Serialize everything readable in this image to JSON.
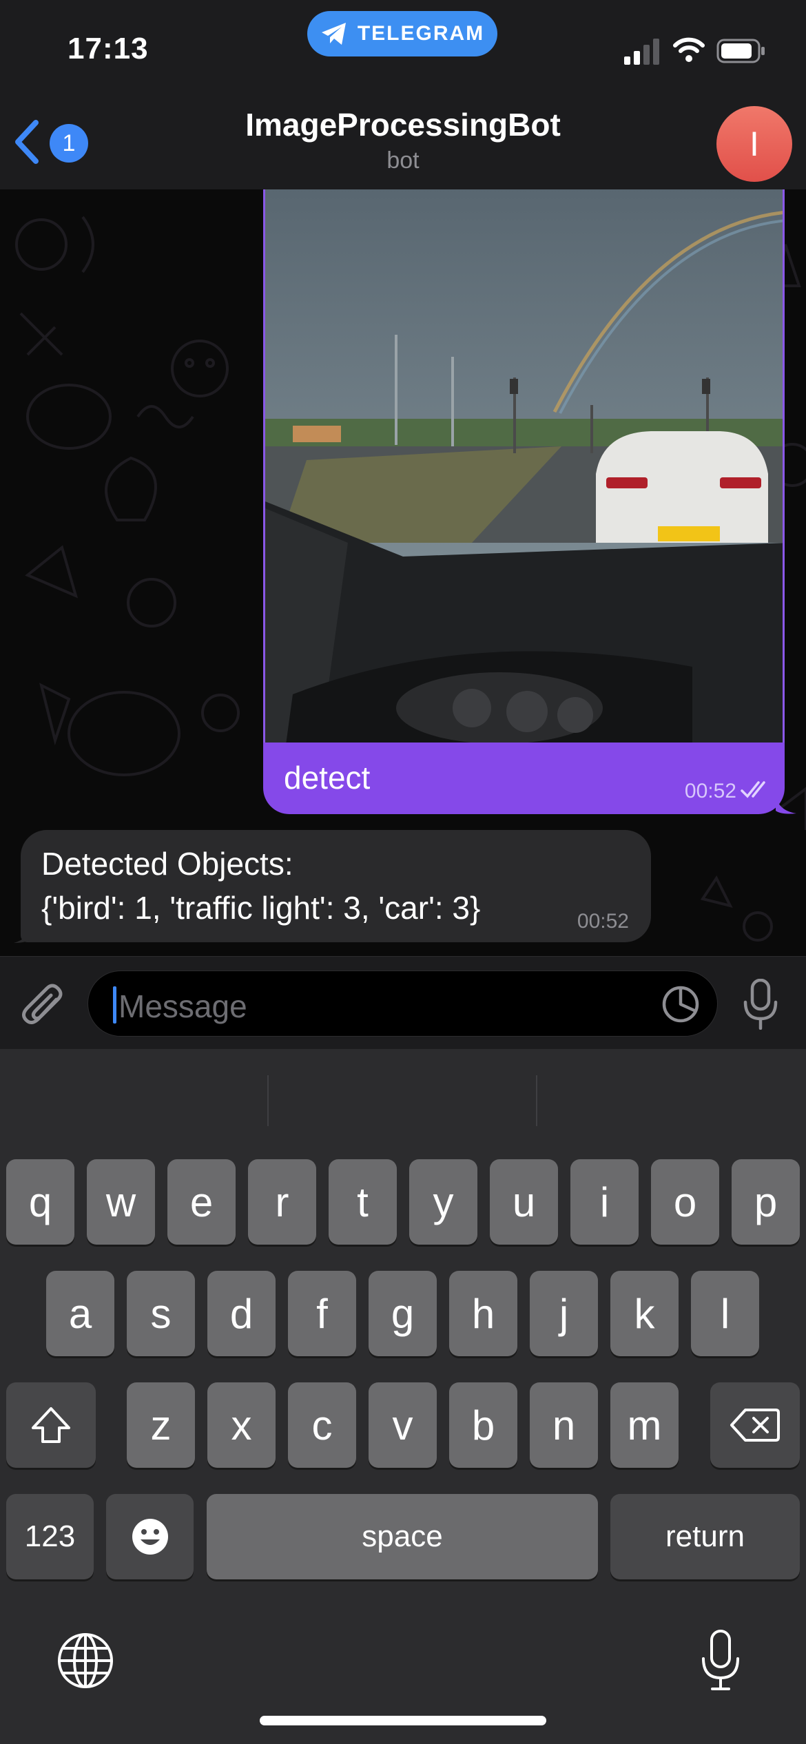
{
  "status": {
    "time": "17:13",
    "pill_label": "TELEGRAM"
  },
  "nav": {
    "back_badge": "1",
    "title": "ImageProcessingBot",
    "subtitle": "bot",
    "avatar_initial": "I"
  },
  "messages": {
    "outgoing": {
      "caption": "detect",
      "time": "00:52"
    },
    "incoming": {
      "line1": "Detected Objects:",
      "line2": "{'bird': 1, 'traffic light': 3, 'car': 3}",
      "time": "00:52"
    }
  },
  "input": {
    "placeholder": "Message"
  },
  "keyboard": {
    "row1": [
      "q",
      "w",
      "e",
      "r",
      "t",
      "y",
      "u",
      "i",
      "o",
      "p"
    ],
    "row2": [
      "a",
      "s",
      "d",
      "f",
      "g",
      "h",
      "j",
      "k",
      "l"
    ],
    "row3": [
      "z",
      "x",
      "c",
      "v",
      "b",
      "n",
      "m"
    ],
    "numbers_label": "123",
    "space_label": "space",
    "return_label": "return"
  },
  "colors": {
    "accent": "#3e88f7",
    "outgoing_bubble": "#8549e9",
    "incoming_bubble": "#2a2a2c",
    "avatar": "#e8564e"
  },
  "icons": [
    "telegram-plane-icon",
    "signal-icon",
    "wifi-icon",
    "battery-icon",
    "back-chevron-icon",
    "double-check-icon",
    "paperclip-icon",
    "sticker-icon",
    "microphone-icon",
    "shift-icon",
    "backspace-icon",
    "emoji-icon",
    "globe-icon"
  ]
}
